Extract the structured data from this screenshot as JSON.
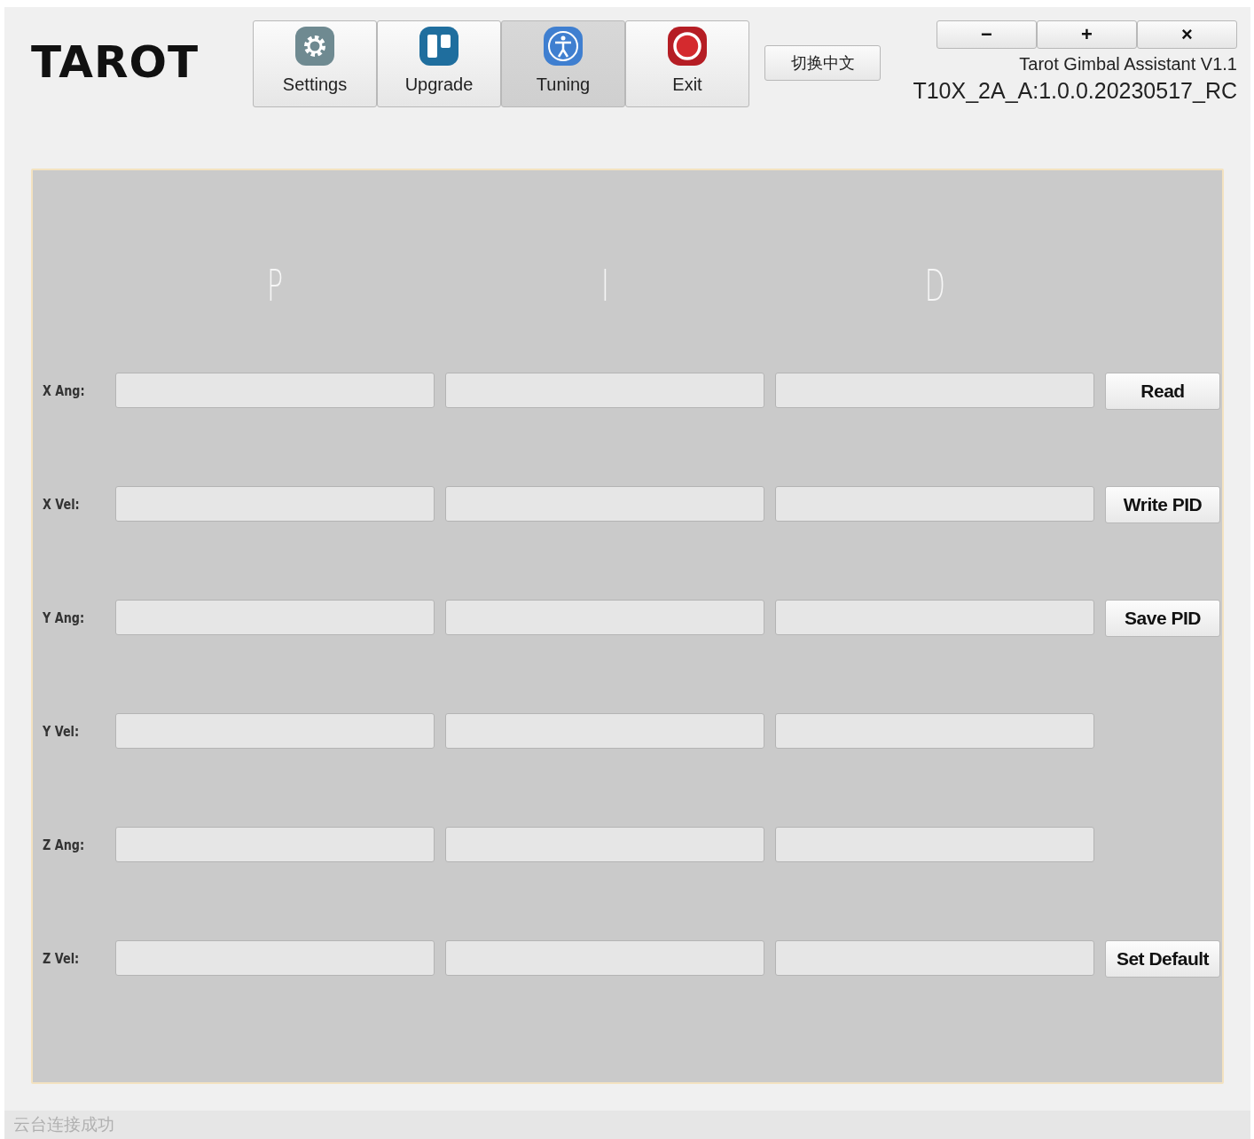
{
  "logo": "TAROT",
  "nav": [
    {
      "label": "Settings",
      "kind": "settings",
      "selected": false
    },
    {
      "label": "Upgrade",
      "kind": "upgrade",
      "selected": false
    },
    {
      "label": "Tuning",
      "kind": "tuning",
      "selected": true
    },
    {
      "label": "Exit",
      "kind": "exit",
      "selected": false
    }
  ],
  "language_button": "切换中文",
  "window_controls": [
    "−",
    "+",
    "×"
  ],
  "app_title": "Tarot Gimbal Assistant V1.1",
  "firmware": "T10X_2A_A:1.0.0.20230517_RC",
  "columns": [
    "P",
    "I",
    "D"
  ],
  "rows": [
    {
      "label": "X Ang:",
      "button": "Read"
    },
    {
      "label": "X Vel:",
      "button": "Write PID"
    },
    {
      "label": "Y Ang:",
      "button": "Save PID"
    },
    {
      "label": "Y Vel:"
    },
    {
      "label": "Z Ang:"
    },
    {
      "label": "Z Vel:",
      "button": "Set Default"
    }
  ],
  "status_bar": "云台连接成功"
}
